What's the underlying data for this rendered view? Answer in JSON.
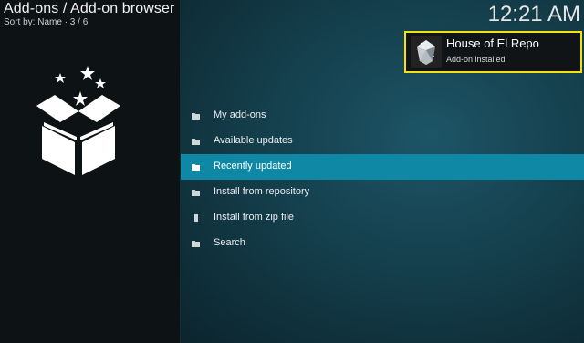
{
  "header": {
    "title": "Add-ons / Add-on browser",
    "sort_info": "Sort by: Name  ·  3 / 6",
    "clock": "12:21 AM"
  },
  "sidebar": {
    "art_icon": "open-box-with-stars-icon"
  },
  "menu": {
    "items": [
      {
        "label": "My add-ons",
        "icon": "folder-icon",
        "active": false
      },
      {
        "label": "Available updates",
        "icon": "folder-icon",
        "active": false
      },
      {
        "label": "Recently updated",
        "icon": "folder-icon",
        "active": true
      },
      {
        "label": "Install from repository",
        "icon": "folder-icon",
        "active": false
      },
      {
        "label": "Install from zip file",
        "icon": "file-icon",
        "active": false
      },
      {
        "label": "Search",
        "icon": "folder-icon",
        "active": false
      }
    ]
  },
  "notification": {
    "title": "House of El Repo",
    "message": "Add-on installed",
    "icon": "diamond-icon",
    "border_color": "#f3e20b"
  },
  "colors": {
    "highlight": "#0e88a4",
    "panel": "#0d1215"
  }
}
